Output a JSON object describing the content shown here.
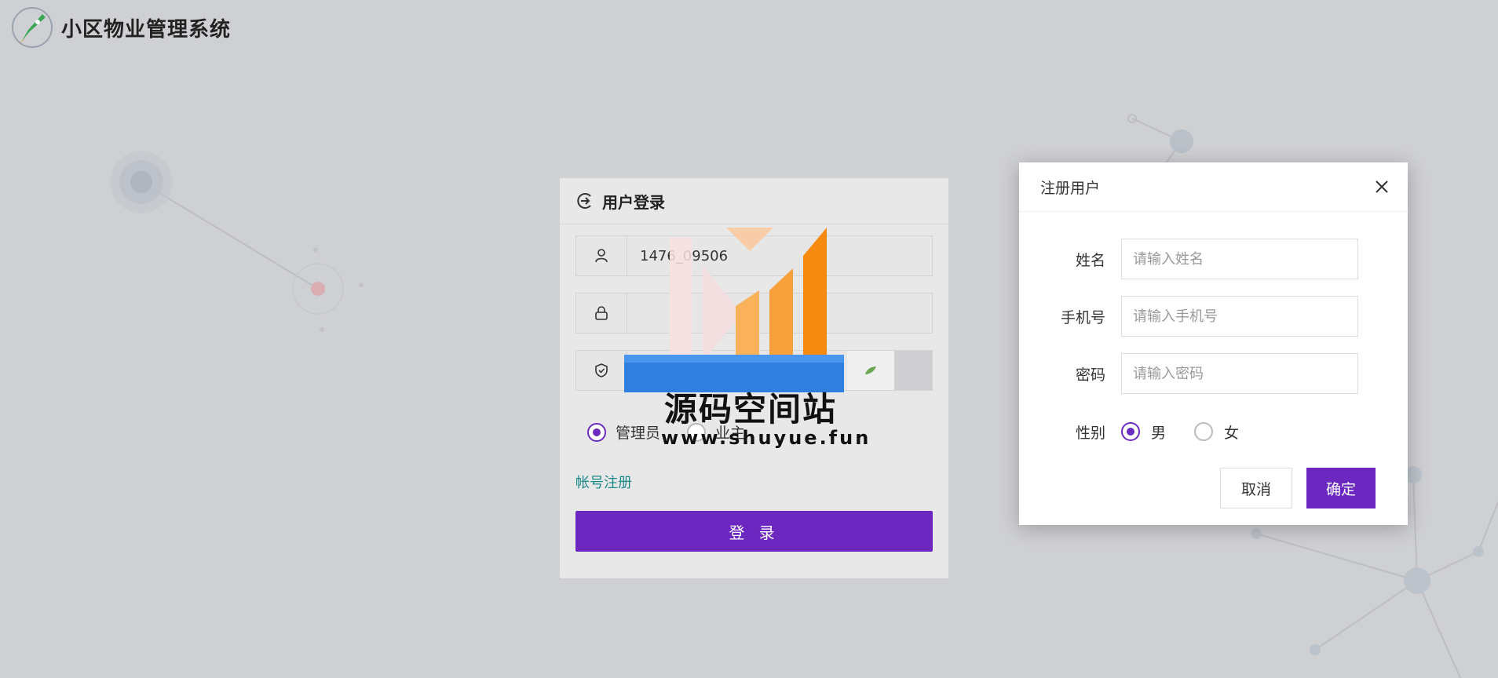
{
  "app": {
    "title": "小区物业管理系统",
    "logo_icon": "rocket-icon"
  },
  "login": {
    "title": "用户登录",
    "username_value": "1476_09506",
    "password_value": "",
    "captcha_value": "",
    "roles": [
      {
        "label": "管理员",
        "selected": true
      },
      {
        "label": "业主",
        "selected": false
      }
    ],
    "register_link": "帐号注册",
    "submit_label": "登 录"
  },
  "watermark": {
    "title": "源码空间站",
    "url": "www.shuyue.fun"
  },
  "register_dialog": {
    "title": "注册用户",
    "fields": [
      {
        "label": "姓名",
        "placeholder": "请输入姓名"
      },
      {
        "label": "手机号",
        "placeholder": "请输入手机号"
      },
      {
        "label": "密码",
        "placeholder": "请输入密码"
      }
    ],
    "gender": {
      "label": "性别",
      "options": [
        {
          "label": "男",
          "selected": true
        },
        {
          "label": "女",
          "selected": false
        }
      ]
    },
    "cancel_label": "取消",
    "confirm_label": "确定"
  },
  "colors": {
    "accent": "#6b27bf",
    "link": "#1d8a8a",
    "background": "#dcdde1"
  }
}
